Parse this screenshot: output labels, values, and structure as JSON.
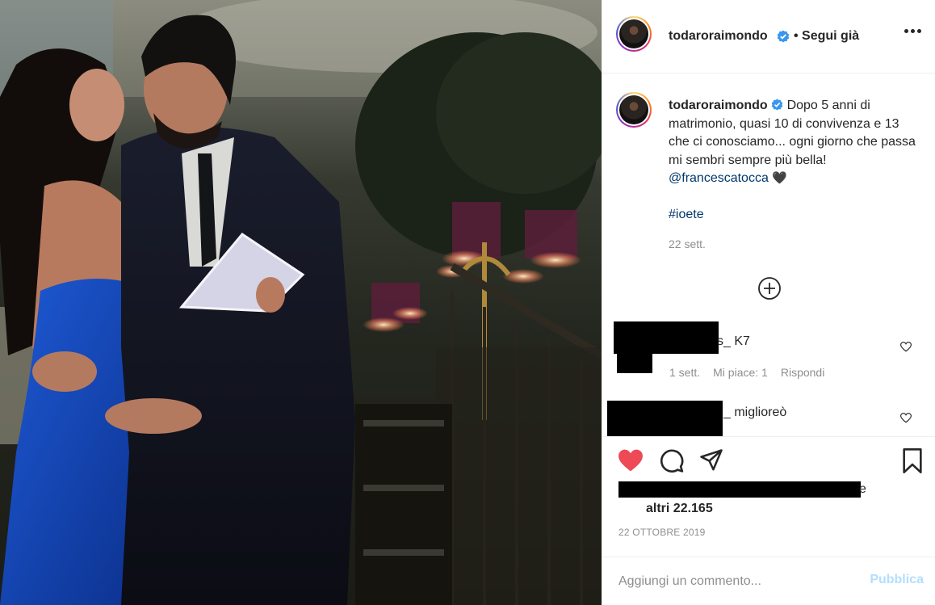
{
  "post": {
    "author": "todaroraimondo",
    "follow_status": "• Segui già",
    "caption_text": "Dopo 5 anni di matrimonio, quasi 10 di convivenza e 13 che ci conosciamo... ogni giorno che passa mi sembri sempre più bella!",
    "mention": "@francescatocca",
    "heart": "🖤",
    "hashtag": "#ioete",
    "caption_time": "22 sett.",
    "likes_partial": "e",
    "likes_count": "altri 22.165",
    "date": "22 ottobre 2019"
  },
  "comments": [
    {
      "text_visible": "s_ K7",
      "time": "1 sett.",
      "likes": "Mi piace: 1",
      "reply": "Rispondi"
    },
    {
      "text_visible": "_ miglioreò"
    }
  ],
  "comment_box": {
    "placeholder": "Aggiungi un commento...",
    "publish": "Pubblica"
  },
  "icons": {
    "verified": "verified-badge-icon",
    "more": "more-options-icon",
    "load_more": "plus-circle-icon",
    "like": "heart-icon",
    "comment": "comment-icon",
    "share": "share-icon",
    "save": "bookmark-icon"
  },
  "colors": {
    "liked_heart": "#ed4956",
    "verified": "#3897f0",
    "link": "#00376b",
    "muted": "#8e8e8e",
    "publish_disabled": "#b2dffc"
  }
}
